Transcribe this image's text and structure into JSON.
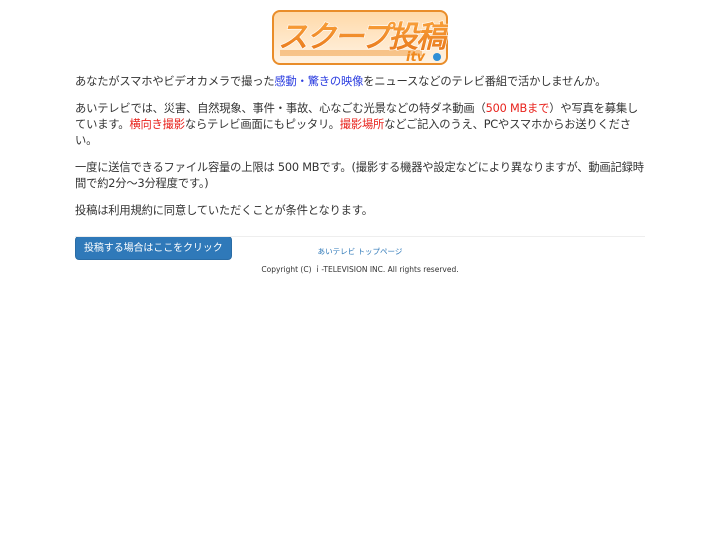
{
  "header": {
    "logo_main": "スクープ投稿",
    "logo_sub": "itv"
  },
  "content": {
    "p1": {
      "before": "あなたがスマホやビデオカメラで撮った",
      "highlight": "感動・驚きの映像",
      "after": "をニュースなどのテレビ番組で活かしませんか。"
    },
    "p2": {
      "part1": "あいテレビでは、災害、自然現象、事件・事故、心なごむ光景などの特ダネ動画（",
      "limit": "500 MBまで",
      "part2": "）や写真を募集しています。",
      "landscape": "横向き撮影",
      "part3": "ならテレビ画面にもピッタリ。",
      "location": "撮影場所",
      "part4": "などご記入のうえ、PCやスマホからお送りください。"
    },
    "p3": "一度に送信できるファイル容量の上限は 500 MBです。(撮影する機器や設定などにより異なりますが、動画記録時間で約2分～3分程度です。)",
    "p4": "投稿は利用規約に同意していただくことが条件となります。",
    "button_label": "投稿する場合はここをクリック"
  },
  "footer": {
    "top_link": "あいテレビ トップページ",
    "copyright": "Copyright (C)  ｉ-TELEVISION   INC. All rights reserved."
  },
  "colors": {
    "highlight_blue": "#2b3de0",
    "highlight_red": "#e8231d",
    "button": "#2f79b9",
    "logo_orange": "#f08a1e"
  }
}
